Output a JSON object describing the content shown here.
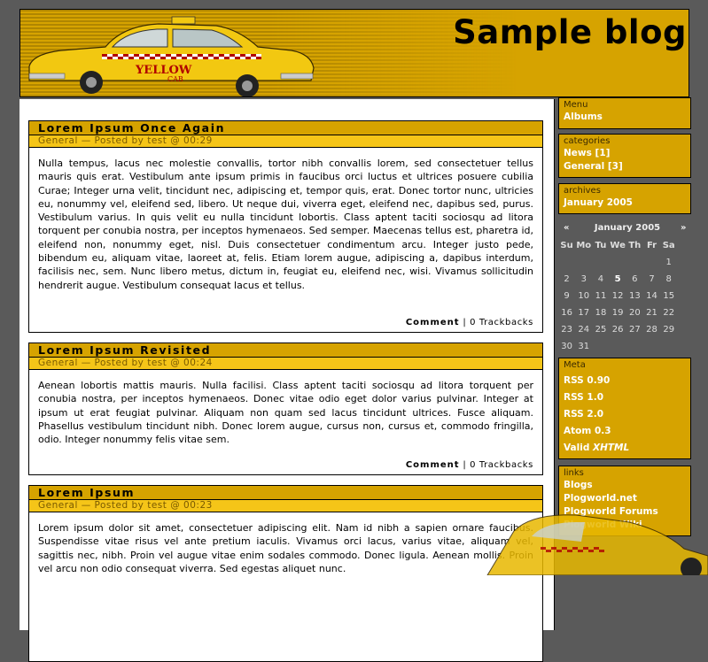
{
  "blog": {
    "title": "Sample blog",
    "logo_text_line1": "YELLOW",
    "logo_text_line2": "CAB"
  },
  "posts": [
    {
      "title": "Lorem Ipsum Once Again",
      "meta": "General — Posted by test @ 00:29",
      "body": "Nulla tempus, lacus nec molestie convallis, tortor nibh convallis lorem, sed consectetuer tellus mauris quis erat. Vestibulum ante ipsum primis in faucibus orci luctus et ultrices posuere cubilia Curae; Integer urna velit, tincidunt nec, adipiscing et, tempor quis, erat. Donec tortor nunc, ultricies eu, nonummy vel, eleifend sed, libero. Ut neque dui, viverra eget, eleifend nec, dapibus sed, purus. Vestibulum varius. In quis velit eu nulla tincidunt lobortis. Class aptent taciti sociosqu ad litora torquent per conubia nostra, per inceptos hymenaeos. Sed semper. Maecenas tellus est, pharetra id, eleifend non, nonummy eget, nisl. Duis consectetuer condimentum arcu. Integer justo pede, bibendum eu, aliquam vitae, laoreet at, felis. Etiam lorem augue, adipiscing a, dapibus interdum, facilisis nec, sem. Nunc libero metus, dictum in, feugiat eu, eleifend nec, wisi. Vivamus sollicitudin hendrerit augue. Vestibulum consequat lacus et tellus.",
      "comment_label": "Comment",
      "separator": "|",
      "trackbacks": "0 Trackbacks"
    },
    {
      "title": "Lorem Ipsum Revisited",
      "meta": "General — Posted by test @ 00:24",
      "body": "Aenean lobortis mattis mauris. Nulla facilisi. Class aptent taciti sociosqu ad litora torquent per conubia nostra, per inceptos hymenaeos. Donec vitae odio eget dolor varius pulvinar. Integer at ipsum ut erat feugiat pulvinar. Aliquam non quam sed lacus tincidunt ultrices. Fusce aliquam. Phasellus vestibulum tincidunt nibh. Donec lorem augue, cursus non, cursus et, commodo fringilla, odio. Integer nonummy felis vitae sem.",
      "comment_label": "Comment",
      "separator": "|",
      "trackbacks": "0 Trackbacks"
    },
    {
      "title": "Lorem Ipsum",
      "meta": "General — Posted by test @ 00:23",
      "body": "Lorem ipsum dolor sit amet, consectetuer adipiscing elit. Nam id nibh a sapien ornare faucibus. Suspendisse vitae risus vel ante pretium iaculis. Vivamus orci lacus, varius vitae, aliquam vel, sagittis nec, nibh. Proin vel augue vitae enim sodales commodo. Donec ligula. Aenean mollis. Proin vel arcu non odio consequat viverra. Sed egestas aliquet nunc."
    }
  ],
  "sidebar": {
    "menu": {
      "title": "Menu",
      "items": [
        "Albums"
      ]
    },
    "categories": {
      "title": "categories",
      "items": [
        "News [1]",
        "General [3]"
      ]
    },
    "archives": {
      "title": "archives",
      "items": [
        "January 2005"
      ]
    },
    "calendar": {
      "prev": "«",
      "month": "January 2005",
      "next": "»",
      "weekdays": [
        "Su",
        "Mo",
        "Tu",
        "We",
        "Th",
        "Fr",
        "Sa"
      ],
      "weeks": [
        [
          "",
          "",
          "",
          "",
          "",
          "",
          "1"
        ],
        [
          "2",
          "3",
          "4",
          "5",
          "6",
          "7",
          "8"
        ],
        [
          "9",
          "10",
          "11",
          "12",
          "13",
          "14",
          "15"
        ],
        [
          "16",
          "17",
          "18",
          "19",
          "20",
          "21",
          "22"
        ],
        [
          "23",
          "24",
          "25",
          "26",
          "27",
          "28",
          "29"
        ],
        [
          "30",
          "31",
          "",
          "",
          "",
          "",
          ""
        ]
      ],
      "highlight_day": "5"
    },
    "meta": {
      "title": "Meta",
      "items": [
        "RSS 0.90",
        "RSS 1.0",
        "RSS 2.0",
        "Atom 0.3"
      ],
      "valid_prefix": "Valid",
      "valid_suffix": "XHTML"
    },
    "links": {
      "title": "links",
      "items": [
        "Blogs",
        "Plogworld.net",
        "Plogworld Forums",
        "Plogworld Wiki"
      ]
    }
  },
  "colors": {
    "page_bg": "#5a5a5a",
    "accent": "#d6a300",
    "accent_light": "#f5c518",
    "link": "#ffffff"
  },
  "icons": [
    "taxi-logo-image",
    "taxi-decoration-image"
  ]
}
